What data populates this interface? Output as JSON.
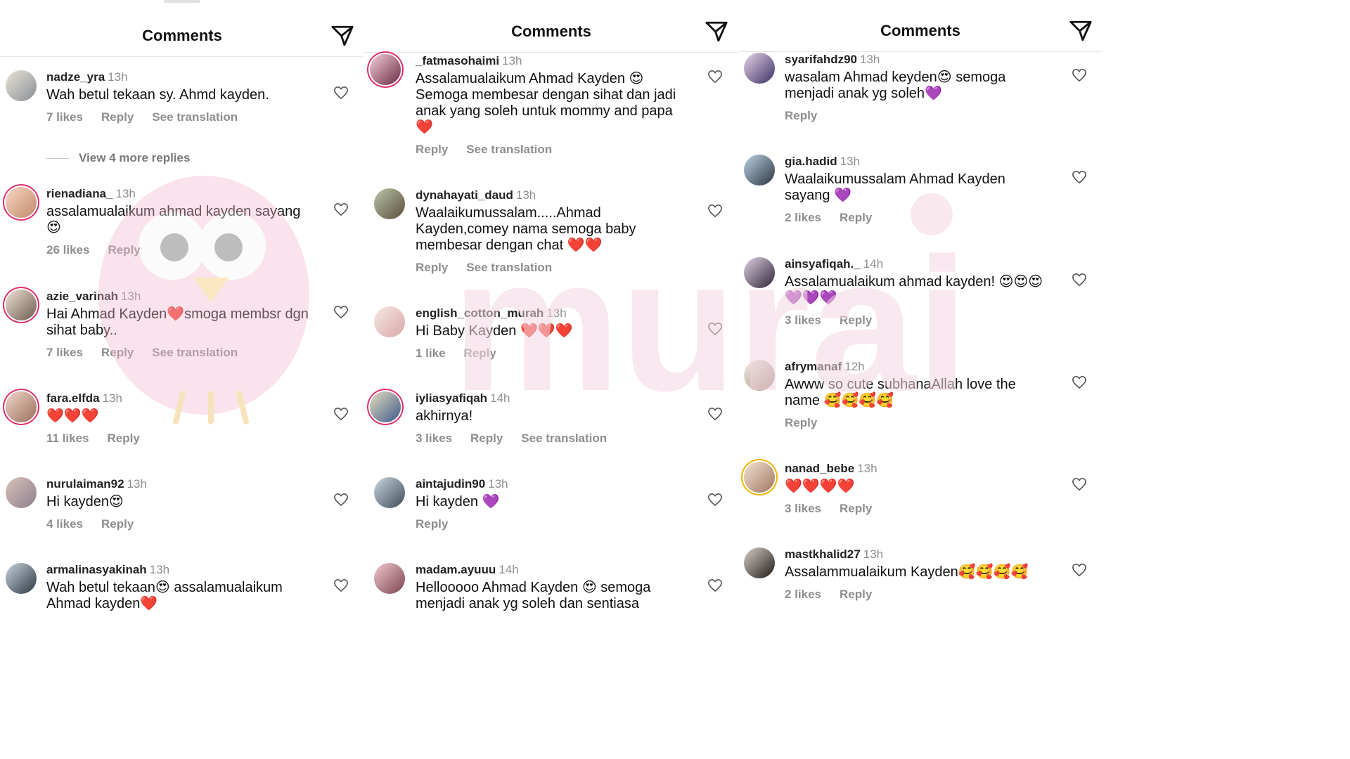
{
  "panels": [
    {
      "title": "Comments",
      "comments": [
        {
          "user": "nadze_yra",
          "time": "13h",
          "text": "Wah betul tekaan sy. Ahmd kayden.",
          "actions": [
            "7 likes",
            "Reply",
            "See translation"
          ],
          "view_more": "View 4 more replies"
        },
        {
          "user": "rienadiana_",
          "time": "13h",
          "text": "assalamualaikum ahmad kayden sayang 😍",
          "actions": [
            "26 likes",
            "Reply"
          ]
        },
        {
          "user": "azie_varinah",
          "time": "13h",
          "text": "Hai Ahmad Kayden❤️smoga membsr dgn sihat baby..",
          "actions": [
            "7 likes",
            "Reply",
            "See translation"
          ]
        },
        {
          "user": "fara.elfda",
          "time": "13h",
          "text": "❤️❤️❤️",
          "actions": [
            "11 likes",
            "Reply"
          ]
        },
        {
          "user": "nurulaiman92",
          "time": "13h",
          "text": "Hi kayden😍",
          "actions": [
            "4 likes",
            "Reply"
          ]
        },
        {
          "user": "armalinasyakinah",
          "time": "13h",
          "text": "Wah betul tekaan😍 assalamualaikum Ahmad kayden❤️",
          "actions": []
        }
      ]
    },
    {
      "title": "Comments",
      "comments": [
        {
          "user": "_fatmasohaimi",
          "time": "13h",
          "text": "Assalamualaikum Ahmad Kayden 😍 Semoga membesar dengan sihat dan jadi anak yang soleh untuk mommy and papa ❤️",
          "actions": [
            "Reply",
            "See translation"
          ]
        },
        {
          "user": "dynahayati_daud",
          "time": "13h",
          "text": "Waalaikumussalam.....Ahmad Kayden,comey nama semoga baby membesar dengan chat ❤️❤️",
          "actions": [
            "Reply",
            "See translation"
          ]
        },
        {
          "user": "english_cotton_murah",
          "time": "13h",
          "text": "Hi Baby Kayden ❤️❤️❤️",
          "actions": [
            "1 like",
            "Reply"
          ]
        },
        {
          "user": "iyliasyafiqah",
          "time": "14h",
          "text": "akhirnya!",
          "actions": [
            "3 likes",
            "Reply",
            "See translation"
          ]
        },
        {
          "user": "aintajudin90",
          "time": "13h",
          "text": "Hi kayden 💜",
          "actions": [
            "Reply"
          ]
        },
        {
          "user": "madam.ayuuu",
          "time": "14h",
          "text": "Hellooooo Ahmad Kayden 😍 semoga menjadi anak yg soleh dan sentiasa",
          "actions": []
        }
      ]
    },
    {
      "title": "Comments",
      "comments": [
        {
          "user": "syarifahdz90",
          "time": "13h",
          "text": "wasalam Ahmad keyden😍 semoga menjadi anak yg soleh💜",
          "actions": [
            "Reply"
          ]
        },
        {
          "user": "gia.hadid",
          "time": "13h",
          "text": "Waalaikumussalam Ahmad Kayden sayang 💜",
          "actions": [
            "2 likes",
            "Reply"
          ]
        },
        {
          "user": "ainsyafiqah._",
          "time": "14h",
          "text": "Assalamualaikum ahmad kayden! 😍😍😍💜💜💜",
          "actions": [
            "3 likes",
            "Reply"
          ]
        },
        {
          "user": "afrymanaf",
          "time": "12h",
          "text": "Awww so cute subhanaAllah love the name 🥰🥰🥰🥰",
          "actions": [
            "Reply"
          ]
        },
        {
          "user": "nanad_bebe",
          "time": "13h",
          "text": "❤️❤️❤️❤️",
          "actions": [
            "3 likes",
            "Reply"
          ]
        },
        {
          "user": "mastkhalid27",
          "time": "13h",
          "text": "Assalammualaikum Kayden🥰🥰🥰🥰",
          "actions": [
            "2 likes",
            "Reply"
          ]
        }
      ]
    }
  ],
  "watermark_text": "murai",
  "colors": {
    "accent": "#e1306c",
    "watermark": "#f4d7e2",
    "muted": "#8e8e8e"
  },
  "icons": {
    "send": "send-icon",
    "like": "heart-outline-icon"
  }
}
